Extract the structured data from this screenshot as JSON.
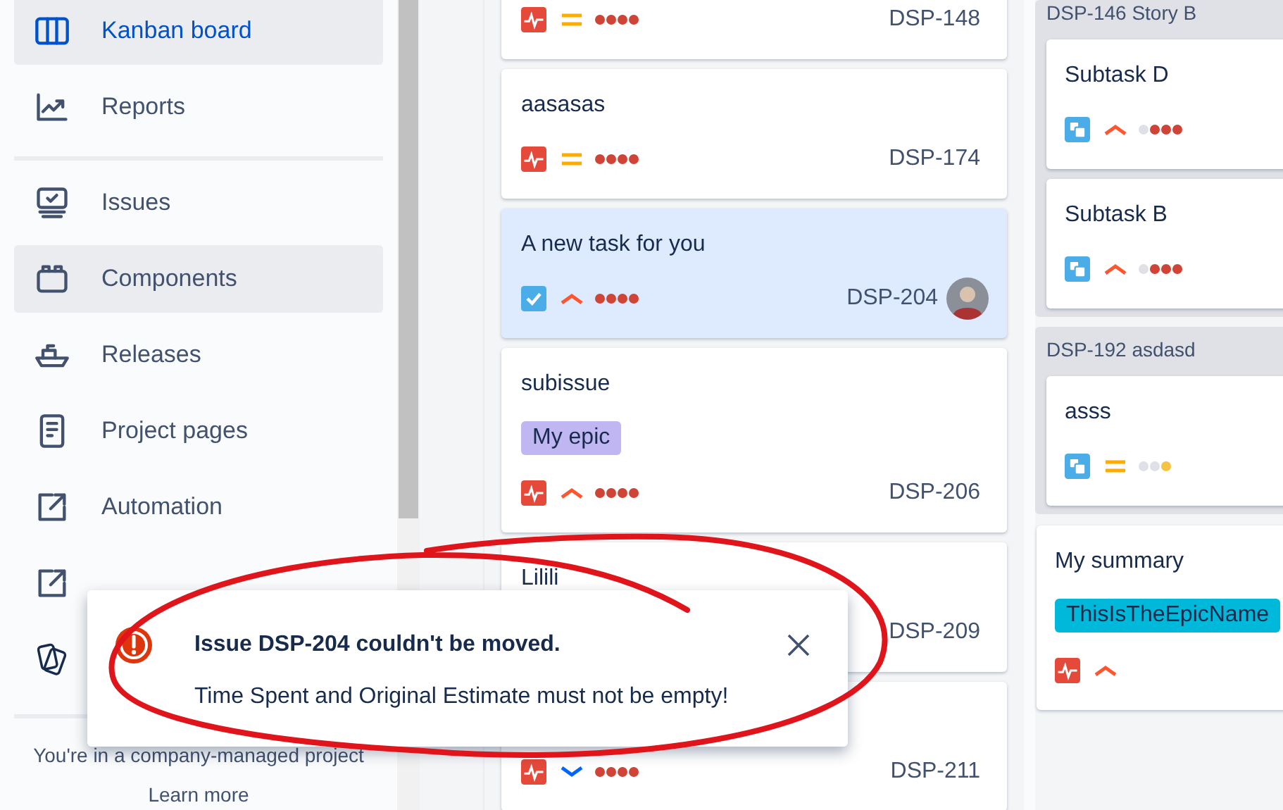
{
  "sidebar": {
    "items": [
      {
        "label": "Kanban board",
        "kind": "board",
        "selected": true
      },
      {
        "label": "Reports",
        "kind": "chart",
        "selected": false
      },
      {
        "label": "Issues",
        "kind": "issues",
        "selected": false,
        "divider_before": true
      },
      {
        "label": "Components",
        "kind": "components",
        "selected": false,
        "hovered": true
      },
      {
        "label": "Releases",
        "kind": "ship",
        "selected": false
      },
      {
        "label": "Project pages",
        "kind": "page",
        "selected": false
      },
      {
        "label": "Automation",
        "kind": "external",
        "selected": false
      },
      {
        "kind": "external",
        "selected": false
      },
      {
        "kind": "cards",
        "selected": false
      }
    ],
    "footer_text": "You're in a company-managed project",
    "footer_link": "Learn more"
  },
  "columns": [
    {
      "cards": [
        {
          "kind": "bug",
          "priority": {
            "kind": "medium"
          },
          "estimate": {
            "kind": "full"
          },
          "key": "DSP-148",
          "selected": false
        },
        {
          "title": "aasasas",
          "kind": "bug",
          "priority": {
            "kind": "medium"
          },
          "estimate": {
            "kind": "full"
          },
          "key": "DSP-174",
          "selected": false
        },
        {
          "title": "A new task for you",
          "kind": "task",
          "priority": {
            "kind": "high"
          },
          "estimate": {
            "kind": "full"
          },
          "key": "DSP-204",
          "selected": true,
          "avatar": true
        },
        {
          "title": "subissue",
          "epic": {
            "label": "My epic",
            "color": "#c0b6f2"
          },
          "kind": "bug",
          "priority": {
            "kind": "high"
          },
          "estimate": {
            "kind": "full"
          },
          "key": "DSP-206",
          "selected": false
        },
        {
          "title": "Lilili",
          "key": "DSP-209",
          "selected": false
        },
        {
          "kind": "bug",
          "priority": {
            "kind": "low"
          },
          "estimate": {
            "kind": "full"
          },
          "key": "DSP-211",
          "selected": false
        }
      ]
    },
    {
      "groups": [
        {
          "key": "DSP-146",
          "title": "Story B",
          "cards": [
            {
              "title": "Subtask D",
              "kind": "subtask",
              "priority": {
                "kind": "high"
              },
              "estimate": {
                "kind": "partial"
              },
              "selected": false
            },
            {
              "title": "Subtask B",
              "kind": "subtask",
              "priority": {
                "kind": "high"
              },
              "estimate": {
                "kind": "partial"
              },
              "selected": false
            }
          ]
        },
        {
          "key": "DSP-192",
          "title": "asdasd",
          "cards": [
            {
              "title": "asss",
              "kind": "subtask",
              "priority": {
                "kind": "medium"
              },
              "estimate": {
                "kind": "low"
              },
              "selected": false
            }
          ]
        }
      ],
      "cards": [
        {
          "title": "My summary",
          "epic": {
            "label": "ThisIsTheEpicName",
            "color": "#00b8d9"
          },
          "kind": "bug",
          "priority": {
            "kind": "high"
          },
          "selected": false
        }
      ]
    }
  ],
  "toast": {
    "title": "Issue DSP-204 couldn't be moved.",
    "message": "Time Spent and Original Estimate must not be empty!"
  },
  "annotation": {
    "kind": "ellipse"
  }
}
